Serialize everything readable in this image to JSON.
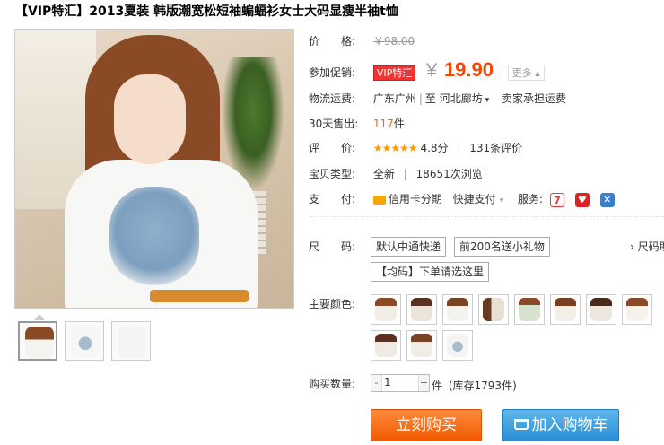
{
  "title": "【VIP特汇】2013夏装 韩版潮宽松短袖蝙蝠衫女士大码显瘦半袖t恤",
  "price": {
    "label": "价　　格:",
    "original": "￥98.00"
  },
  "promo": {
    "label": "参加促销:",
    "badge": "VIP特汇",
    "currency": "￥",
    "price": "19.90",
    "more": "更多"
  },
  "shipping": {
    "label": "物流运费:",
    "from": "广东广州",
    "to_prefix": "至",
    "to": "河北廊坊",
    "fee": "卖家承担运费"
  },
  "sold": {
    "label": "30天售出:",
    "count": "117",
    "unit": "件"
  },
  "rating": {
    "label": "评　　价:",
    "stars": "★★★★★",
    "score": "4.8分",
    "reviews": "131条评价"
  },
  "item_type": {
    "label": "宝贝类型:",
    "condition": "全新",
    "views": "18651次浏览"
  },
  "payment": {
    "label": "支　　付:",
    "credit": "信用卡分期",
    "quick": "快捷支付",
    "service_label": "服务:",
    "svc1": "7",
    "svc2": "♥",
    "svc3": "✕"
  },
  "size": {
    "label": "尺　　码:",
    "options": [
      "默认中通快递",
      "前200名送小礼物",
      "【均码】下单请选这里"
    ],
    "more": "› 尺码助"
  },
  "color": {
    "label": "主要颜色:"
  },
  "quantity": {
    "label": "购买数量:",
    "value": "1",
    "unit": "件",
    "stock": "(库存1793件)"
  },
  "buttons": {
    "buy": "立刻购买",
    "cart": "加入购物车"
  },
  "colors": {
    "accent": "#ff4400",
    "buy": "#f15a00",
    "cart": "#2a8fd6",
    "vip": "#ee3333"
  }
}
